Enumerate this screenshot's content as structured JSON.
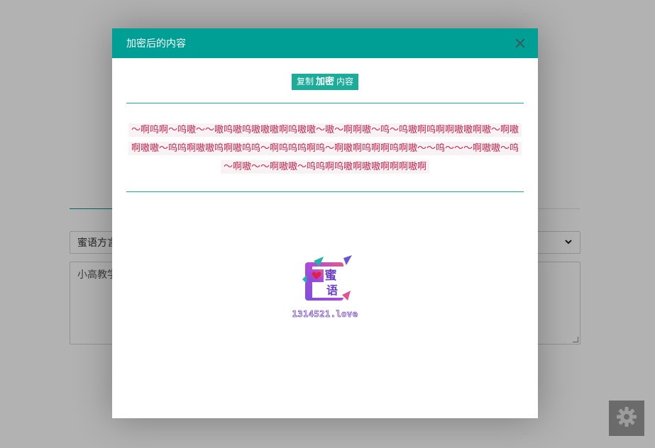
{
  "page": {
    "dialect_select": {
      "value": "蜜语方言",
      "chevron": "chevron-down-icon"
    },
    "source_textarea": {
      "value": "小高教学"
    },
    "settings_button": {
      "icon": "gear-icon"
    }
  },
  "modal": {
    "title": "加密后的内容",
    "close_icon": "close-icon",
    "copy_button": {
      "pre": "复制",
      "strong": "加密",
      "post": "内容"
    },
    "cipher_text": "～啊呜啊～呜嗷～～嗷呜嗷呜嗷嗷嗷啊呜嗷嗷～嗷～啊啊嗷～呜～呜嗷啊呜啊啊嗷嗷啊嗷～啊嗷啊嗷嗷～呜呜啊嗷嗷呜啊嗷呜呜～啊呜呜呜啊呜～啊嗷啊呜啊啊呜啊嗷～～呜～～～啊嗷嗷～呜～啊嗷～～啊嗷嗷～呜呜啊呜嗷啊嗷嗷啊啊啊嗷啊",
    "logo": {
      "char_top": "蜜",
      "char_bottom": "语",
      "caption": "1314521.love"
    }
  },
  "colors": {
    "header": "#009f95",
    "button": "#1cad9a",
    "cipher": "#c7254e",
    "cipher_bg": "#f9f2f4"
  }
}
